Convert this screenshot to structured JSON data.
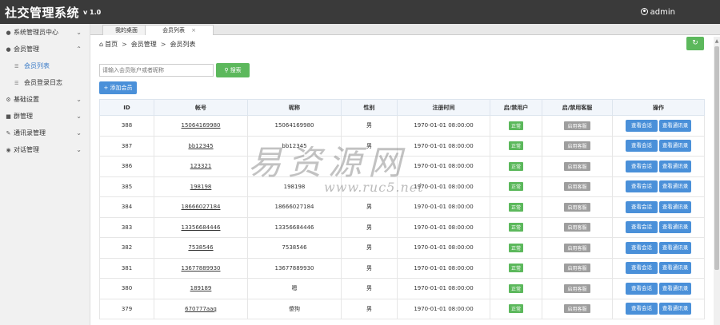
{
  "header": {
    "title": "社交管理系统",
    "version": "v 1.0",
    "user": "admin"
  },
  "sidebar": {
    "items": [
      {
        "label": "系统管理员中心",
        "icon": "user-icon"
      },
      {
        "label": "会员管理",
        "icon": "user-icon"
      },
      {
        "label": "基础设置",
        "icon": "gear-icon"
      },
      {
        "label": "群管理",
        "icon": "briefcase-icon"
      },
      {
        "label": "通讯录管理",
        "icon": "edit-icon"
      },
      {
        "label": "对话管理",
        "icon": "eye-icon"
      }
    ],
    "subitems": [
      {
        "label": "会员列表",
        "icon": "list-icon"
      },
      {
        "label": "会员登录日志",
        "icon": "list-icon"
      }
    ]
  },
  "tabs": [
    {
      "label": "我的桌面"
    },
    {
      "label": "会员列表",
      "close": "×"
    }
  ],
  "breadcrumb": {
    "home": "首页",
    "sep": ">",
    "level1": "会员管理",
    "level2": "会员列表"
  },
  "toolbar": {
    "search_placeholder": "请输入会员账户或者昵称",
    "search_label": "搜索",
    "add_label": "添加会员",
    "refresh_icon": "refresh-icon"
  },
  "table": {
    "headers": [
      "ID",
      "帐号",
      "昵称",
      "性别",
      "注册时间",
      "启/禁用户",
      "启/禁用客服",
      "操作"
    ],
    "status_label": "正常",
    "cs_label": "启用客服",
    "op1_label": "查看会话",
    "op2_label": "查看通讯录",
    "rows": [
      {
        "id": "388",
        "account": "15064169980",
        "nick": "15064169980",
        "gender": "男",
        "time": "1970-01-01 08:00:00"
      },
      {
        "id": "387",
        "account": "bb12345",
        "nick": "bb12345",
        "gender": "男",
        "time": "1970-01-01 08:00:00"
      },
      {
        "id": "386",
        "account": "123321",
        "nick": "",
        "gender": "",
        "time": "1970-01-01 08:00:00"
      },
      {
        "id": "385",
        "account": "198198",
        "nick": "198198",
        "gender": "",
        "time": "1970-01-01 08:00:00"
      },
      {
        "id": "384",
        "account": "18666027184",
        "nick": "18666027184",
        "gender": "男",
        "time": "1970-01-01 08:00:00"
      },
      {
        "id": "383",
        "account": "13356684446",
        "nick": "13356684446",
        "gender": "男",
        "time": "1970-01-01 08:00:00"
      },
      {
        "id": "382",
        "account": "7538546",
        "nick": "7538546",
        "gender": "男",
        "time": "1970-01-01 08:00:00"
      },
      {
        "id": "381",
        "account": "13677889930",
        "nick": "13677889930",
        "gender": "男",
        "time": "1970-01-01 08:00:00"
      },
      {
        "id": "380",
        "account": "189189",
        "nick": "嗯",
        "gender": "男",
        "time": "1970-01-01 08:00:00"
      },
      {
        "id": "379",
        "account": "670777aaq",
        "nick": "傻狗",
        "gender": "男",
        "time": "1970-01-01 08:00:00"
      }
    ]
  },
  "watermark": {
    "text": "易资源网",
    "url": "www.ruc5.net"
  },
  "colors": {
    "topbar": "#3a3a3a",
    "green": "#5cb85c",
    "blue": "#4a90d9",
    "gray_badge": "#9e9e9e",
    "active_link": "#3a7bc8"
  }
}
